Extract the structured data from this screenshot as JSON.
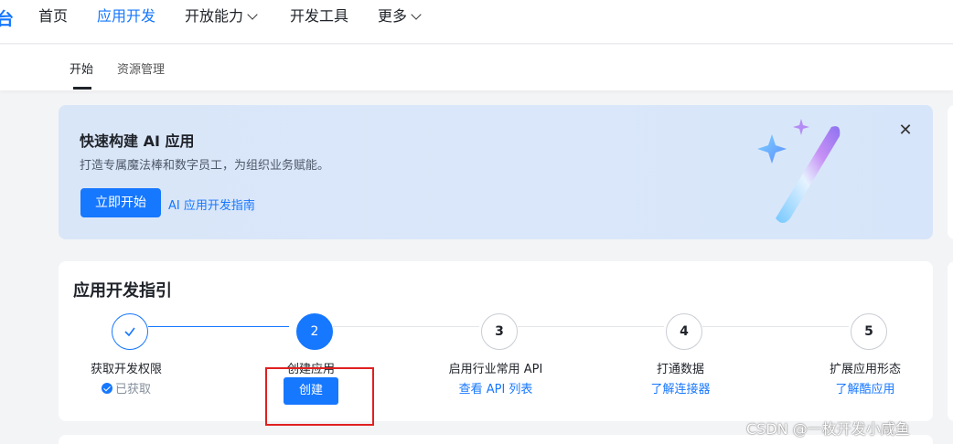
{
  "topnav": {
    "logo_fragment": "台",
    "items": [
      {
        "label": "首页",
        "active": false,
        "dropdown": false
      },
      {
        "label": "应用开发",
        "active": true,
        "dropdown": false
      },
      {
        "label": "开放能力",
        "active": false,
        "dropdown": true
      },
      {
        "label": "开发工具",
        "active": false,
        "dropdown": false
      },
      {
        "label": "更多",
        "active": false,
        "dropdown": true
      }
    ]
  },
  "subnav": {
    "tabs": [
      {
        "label": "开始",
        "active": true
      },
      {
        "label": "资源管理",
        "active": false
      }
    ]
  },
  "banner": {
    "title": "快速构建 AI 应用",
    "description": "打造专属魔法棒和数字员工，为组织业务赋能。",
    "primary_button": "立即开始",
    "guide_link": "AI 应用开发指南",
    "close_icon": "close-icon",
    "illustration_icon": "magic-wand-icon"
  },
  "guide": {
    "title": "应用开发指引",
    "steps": [
      {
        "number": "",
        "label": "获取开发权限",
        "status": "done",
        "sub_text": "已获取",
        "sub_type": "muted"
      },
      {
        "number": "2",
        "label": "创建应用",
        "status": "current",
        "sub_text": "创建",
        "sub_type": "button"
      },
      {
        "number": "3",
        "label": "启用行业常用 API",
        "status": "pending",
        "sub_text": "查看 API 列表",
        "sub_type": "link"
      },
      {
        "number": "4",
        "label": "打通数据",
        "status": "pending",
        "sub_text": "了解连接器",
        "sub_type": "link"
      },
      {
        "number": "5",
        "label": "扩展应用形态",
        "status": "pending",
        "sub_text": "了解酷应用",
        "sub_type": "link"
      }
    ]
  },
  "watermark": "CSDN @一枚开发小咸鱼",
  "colors": {
    "accent": "#1677ff",
    "annotation_red": "#e02020"
  }
}
